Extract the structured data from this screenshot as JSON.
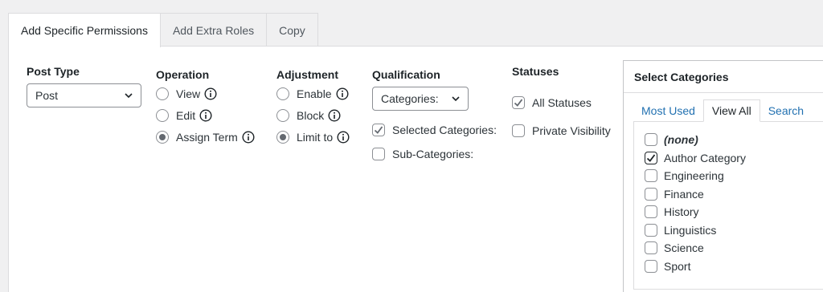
{
  "tabs": [
    {
      "label": "Add Specific Permissions",
      "active": true
    },
    {
      "label": "Add Extra Roles",
      "active": false
    },
    {
      "label": "Copy",
      "active": false
    }
  ],
  "post_type": {
    "title": "Post Type",
    "selected": "Post"
  },
  "operation": {
    "title": "Operation",
    "options": [
      {
        "label": "View",
        "checked": false
      },
      {
        "label": "Edit",
        "checked": false
      },
      {
        "label": "Assign Term",
        "checked": true
      }
    ]
  },
  "adjustment": {
    "title": "Adjustment",
    "options": [
      {
        "label": "Enable",
        "checked": false
      },
      {
        "label": "Block",
        "checked": false
      },
      {
        "label": "Limit to",
        "checked": true
      }
    ]
  },
  "qualification": {
    "title": "Qualification",
    "selected": "Categories:",
    "options": [
      {
        "label": "Selected Categories:",
        "checked": true
      },
      {
        "label": "Sub-Categories:",
        "checked": false
      }
    ]
  },
  "statuses": {
    "title": "Statuses",
    "options": [
      {
        "label": "All Statuses",
        "checked": true
      },
      {
        "label": "Private Visibility",
        "checked": false
      }
    ]
  },
  "select_categories": {
    "title": "Select Categories",
    "tabs": [
      {
        "label": "Most Used",
        "active": false
      },
      {
        "label": "View All",
        "active": true
      },
      {
        "label": "Search",
        "active": false
      }
    ],
    "items": [
      {
        "label": "(none)",
        "checked": false
      },
      {
        "label": "Author Category",
        "checked": true
      },
      {
        "label": "Engineering",
        "checked": false
      },
      {
        "label": "Finance",
        "checked": false
      },
      {
        "label": "History",
        "checked": false
      },
      {
        "label": "Linguistics",
        "checked": false
      },
      {
        "label": "Science",
        "checked": false
      },
      {
        "label": "Sport",
        "checked": false
      }
    ]
  },
  "colors": {
    "accent": "#2271b1",
    "check": "#646970",
    "border": "#8c8f94"
  }
}
